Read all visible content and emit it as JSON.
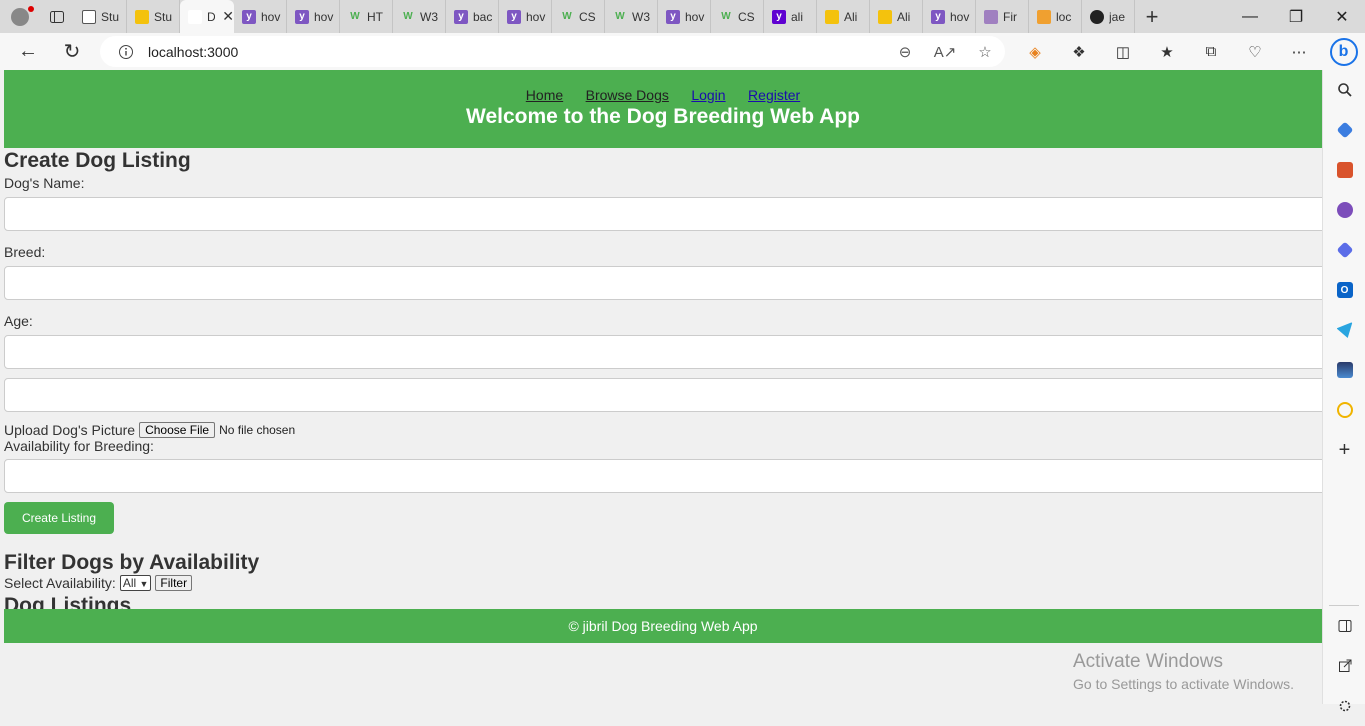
{
  "browser": {
    "tabs": [
      {
        "label": "Stu",
        "icon": "page-icon",
        "color": "#ffffff"
      },
      {
        "label": "Stu",
        "icon": "bolt-icon",
        "color": "#f4c20d"
      },
      {
        "label": "Dog",
        "icon": "",
        "color": "#ffffff",
        "active": true
      },
      {
        "label": "hov",
        "icon": "yahoo-icon",
        "color": "#7e57c2"
      },
      {
        "label": "hov",
        "icon": "yahoo-icon",
        "color": "#7e57c2"
      },
      {
        "label": "HT",
        "icon": "w3-icon",
        "color": "#4caf50"
      },
      {
        "label": "W3",
        "icon": "w3-icon",
        "color": "#4caf50"
      },
      {
        "label": "bac",
        "icon": "yahoo-icon",
        "color": "#7e57c2"
      },
      {
        "label": "hov",
        "icon": "yahoo-icon",
        "color": "#7e57c2"
      },
      {
        "label": "CS",
        "icon": "w3-icon",
        "color": "#4caf50"
      },
      {
        "label": "W3",
        "icon": "w3-icon",
        "color": "#4caf50"
      },
      {
        "label": "hov",
        "icon": "yahoo-icon",
        "color": "#7e57c2"
      },
      {
        "label": "CS",
        "icon": "w3-icon",
        "color": "#4caf50"
      },
      {
        "label": "ali",
        "icon": "yahoo-icon",
        "color": "#5f01d1"
      },
      {
        "label": "Ali",
        "icon": "ali-icon",
        "color": "#f4c20d"
      },
      {
        "label": "Ali",
        "icon": "ali-icon",
        "color": "#f4c20d"
      },
      {
        "label": "hov",
        "icon": "yahoo-icon",
        "color": "#7e57c2"
      },
      {
        "label": "Fir",
        "icon": "stripe-icon",
        "color": "#a080c0"
      },
      {
        "label": "loc",
        "icon": "pma-icon",
        "color": "#f0a030"
      },
      {
        "label": "jae",
        "icon": "github-icon",
        "color": "#222222"
      }
    ],
    "address": "localhost:3000"
  },
  "site": {
    "nav": {
      "home": "Home",
      "browse": "Browse Dogs",
      "login": "Login",
      "register": "Register"
    },
    "title": "Welcome to the Dog Breeding Web App"
  },
  "create": {
    "heading": "Create Dog Listing",
    "name_label": "Dog's Name:",
    "breed_label": "Breed:",
    "age_label": "Age:",
    "picture_label": "Upload Dog's Picture",
    "choose_file": "Choose File",
    "no_file": "No file chosen",
    "availability_label": "Availability for Breeding:",
    "submit": "Create Listing"
  },
  "filter": {
    "heading": "Filter Dogs by Availability",
    "select_label": "Select Availability:",
    "selected": "All",
    "button": "Filter"
  },
  "listings": {
    "heading": "Dog Listings"
  },
  "footer": {
    "text": "© jibril Dog Breeding Web App"
  },
  "watermark": {
    "line1": "Activate Windows",
    "line2": "Go to Settings to activate Windows."
  },
  "colors": {
    "accent": "#4caf50"
  }
}
